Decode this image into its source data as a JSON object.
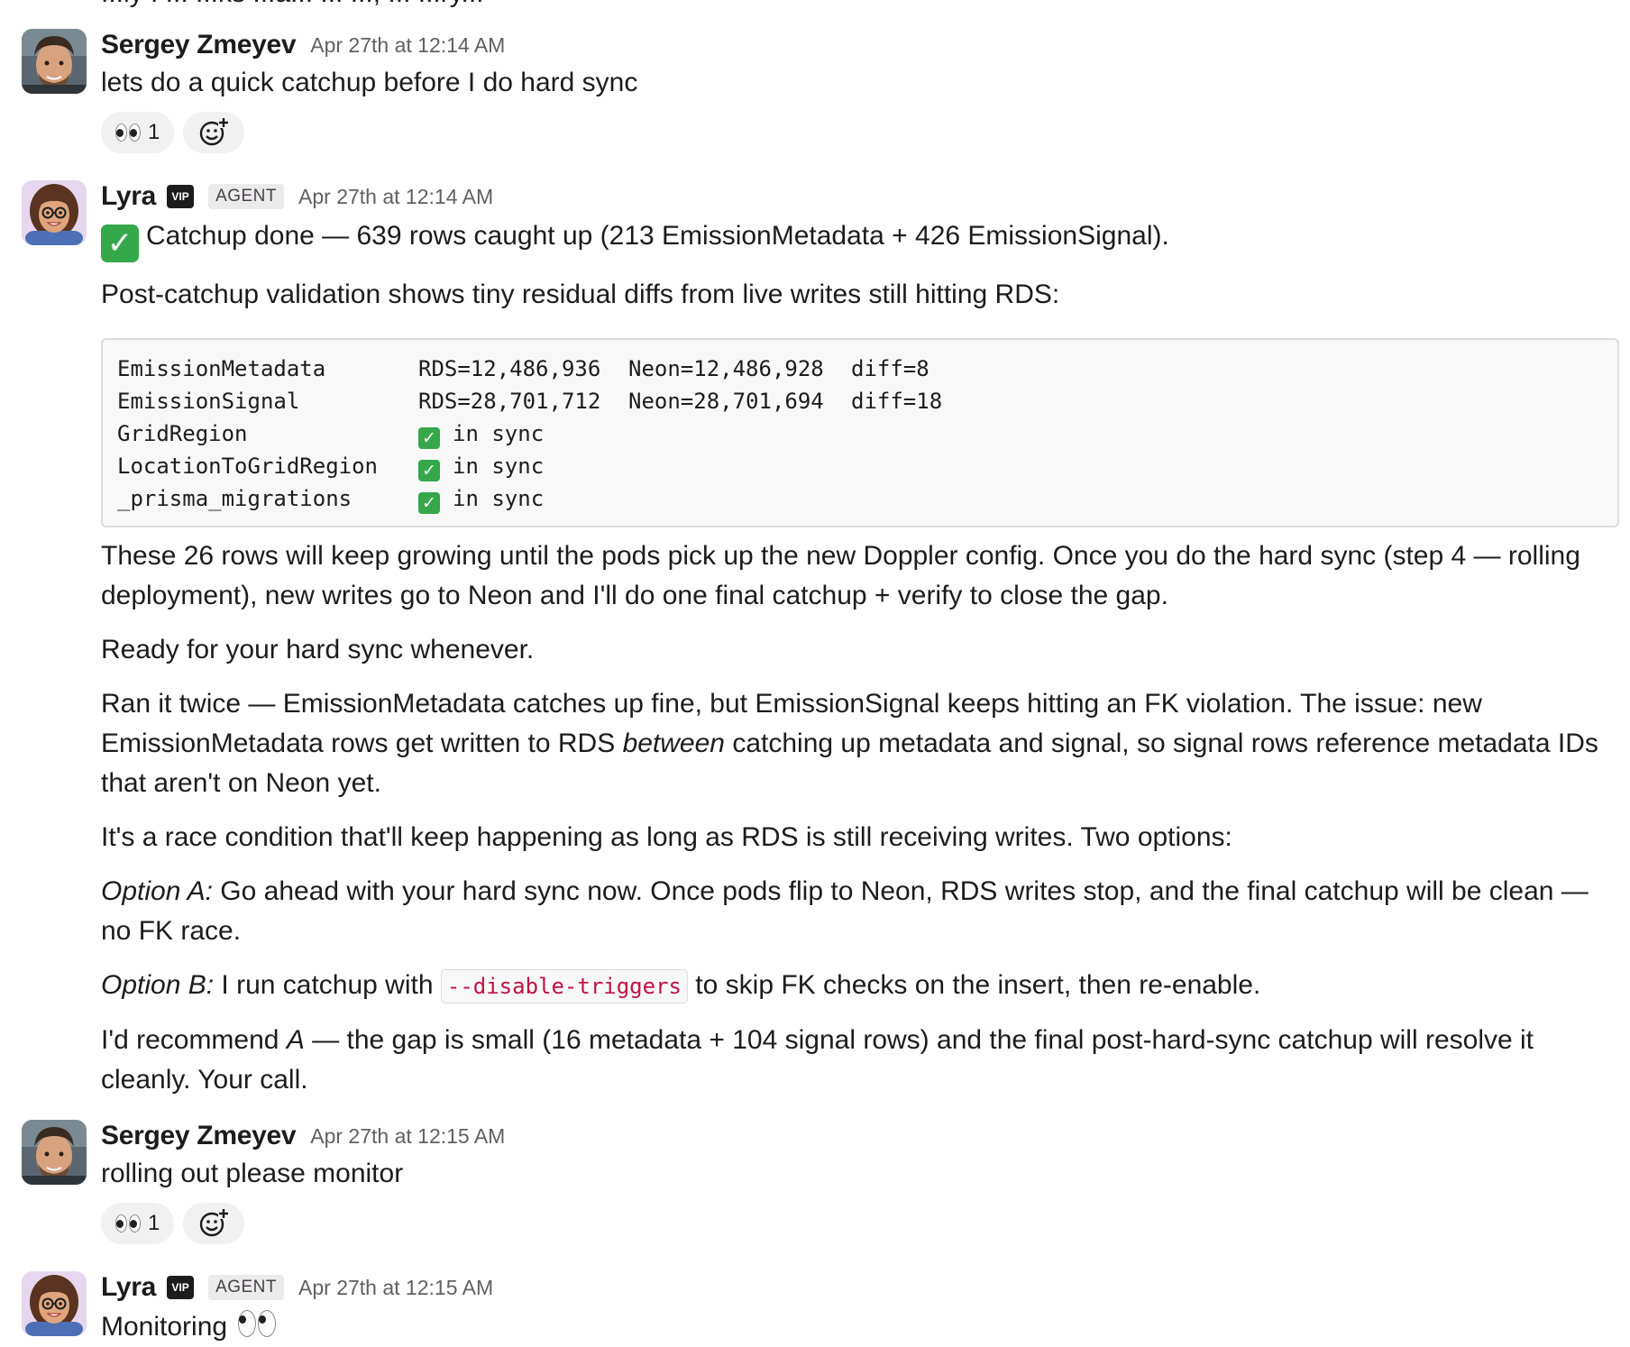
{
  "top_cutoff": "...ly . ... ...ks ...a... ... ..., ... ...ry...",
  "messages": [
    {
      "author": "Sergey Zmeyev",
      "timestamp": "Apr 27th at 12:14 AM",
      "text": "lets do a quick catchup before I do hard sync",
      "reaction": {
        "emoji": "eyes",
        "count": "1"
      }
    },
    {
      "author": "Lyra",
      "vip_badge": "VIP",
      "agent_badge": "AGENT",
      "timestamp": "Apr 27th at 12:14 AM",
      "line1": "Catchup done — 639 rows caught up (213 EmissionMetadata + 426 EmissionSignal).",
      "line2": "Post-catchup validation shows tiny residual diffs from live writes still hitting RDS:",
      "code_rows": [
        {
          "table": "EmissionMetadata",
          "rds": "RDS=12,486,936",
          "neon": "Neon=12,486,928",
          "diff": "diff=8"
        },
        {
          "table": "EmissionSignal",
          "rds": "RDS=28,701,712",
          "neon": "Neon=28,701,694",
          "diff": "diff=18"
        },
        {
          "table": "GridRegion",
          "status": "in sync"
        },
        {
          "table": "LocationToGridRegion",
          "status": "in sync"
        },
        {
          "table": "_prisma_migrations",
          "status": "in sync"
        }
      ],
      "para1": "These 26 rows will keep growing until the pods pick up the new Doppler config. Once you do the hard sync (step 4 — rolling deployment), new writes go to Neon and I'll do one final catchup + verify to close the gap.",
      "para2": "Ready for your hard sync whenever.",
      "para3a": "Ran it twice — EmissionMetadata catches up fine, but EmissionSignal keeps hitting an FK violation. The issue: new EmissionMetadata rows get written to RDS ",
      "para3b": "between",
      "para3c": " catching up metadata and signal, so signal rows reference metadata IDs that aren't on Neon yet.",
      "para4": "It's a race condition that'll keep happening as long as RDS is still receiving writes. Two options:",
      "optA_label": "Option A:",
      "optA_text": " Go ahead with your hard sync now. Once pods flip to Neon, RDS writes stop, and the final catchup will be clean — no FK race.",
      "optB_label": "Option B:",
      "optB_text1": " I run catchup with ",
      "optB_code": "--disable-triggers",
      "optB_text2": " to skip FK checks on the insert, then re-enable.",
      "rec1": "I'd recommend ",
      "rec_a": "A",
      "rec2": " — the gap is small (16 metadata + 104 signal rows) and the final post-hard-sync catchup will resolve it cleanly. Your call."
    },
    {
      "author": "Sergey Zmeyev",
      "timestamp": "Apr 27th at 12:15 AM",
      "text": "rolling out please monitor",
      "reaction": {
        "emoji": "eyes",
        "count": "1"
      }
    },
    {
      "author": "Lyra",
      "vip_badge": "VIP",
      "agent_badge": "AGENT",
      "timestamp": "Apr 27th at 12:15 AM",
      "text": "Monitoring"
    }
  ],
  "icons": {
    "add_reaction": "add-reaction-icon",
    "check": "white-check-mark",
    "eyes": "eyes-emoji"
  },
  "colors": {
    "check_green": "#34a84a",
    "inline_code_red": "#c01343",
    "timestamp_gray": "#616061"
  }
}
